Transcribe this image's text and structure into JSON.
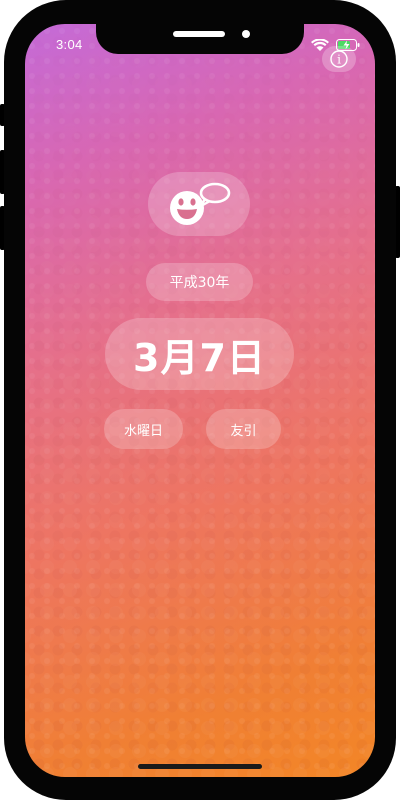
{
  "status_bar": {
    "time": "3:04",
    "icons": [
      "wifi-icon",
      "battery-charging-icon"
    ]
  },
  "header": {
    "info_icon": "info-icon",
    "info_glyph": "i"
  },
  "main": {
    "app_icon": "smiley-speech-bubble-icon",
    "era_year": "平成30年",
    "date": "3月7日",
    "weekday": "水曜日",
    "rokuyo": "友引"
  },
  "colors": {
    "gradient_top": "#c46ad8",
    "gradient_bottom": "#f38626",
    "pill_fill": "rgba(255,255,255,0.22)",
    "text": "#ffffff"
  }
}
